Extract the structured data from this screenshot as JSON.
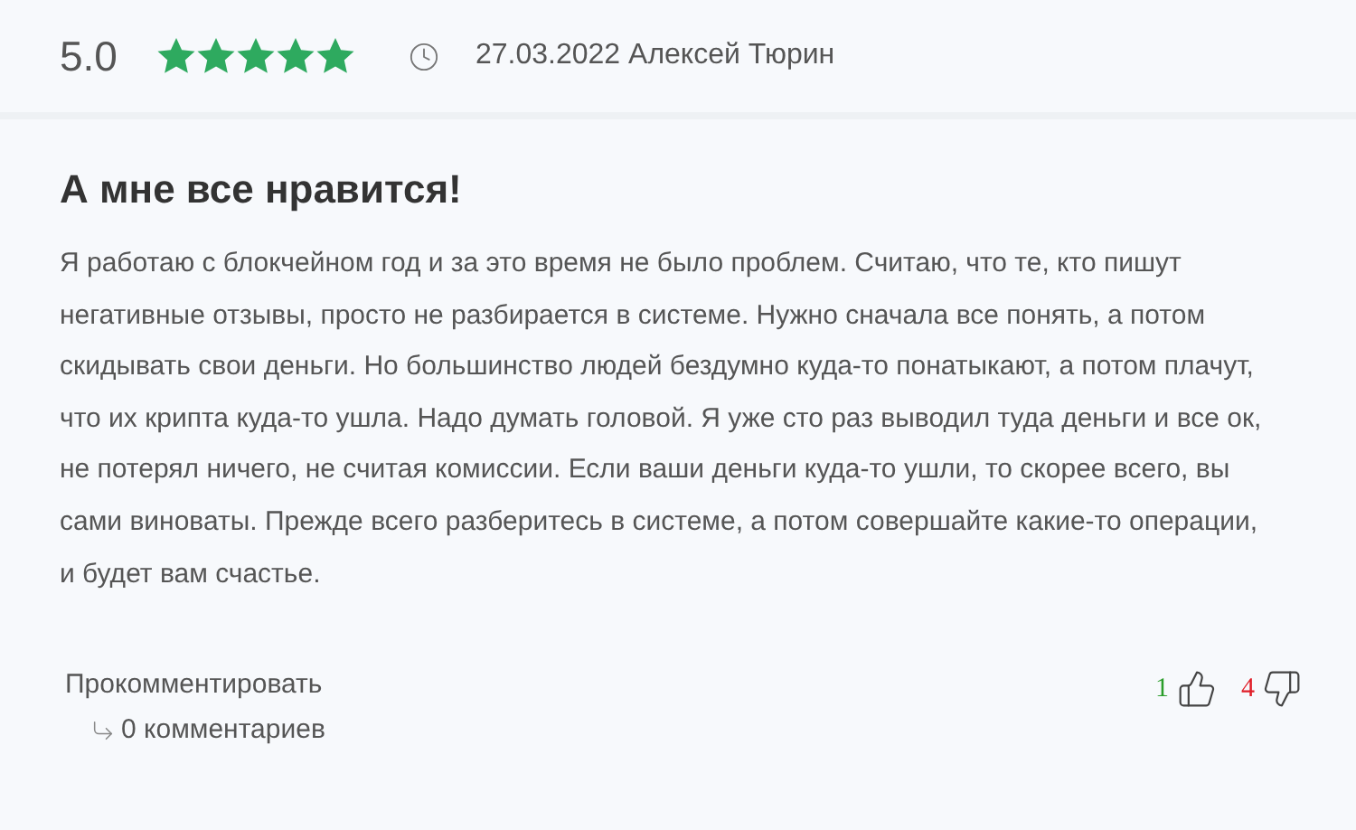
{
  "review": {
    "rating": "5.0",
    "stars": 5,
    "date": "27.03.2022",
    "author": "Алексей Тюрин",
    "title": "А мне все нравится!",
    "text": "Я работаю с блокчейном год и за это время не было проблем. Считаю, что те, кто пишут негативные отзывы, просто не разбирается в системе. Нужно сначала все понять, а потом скидывать свои деньги. Но большинство людей бездумно куда-то понатыкают, а потом плачут, что их крипта куда-то ушла. Надо думать головой. Я уже сто раз выводил туда деньги и все ок, не потерял ничего, не считая комиссии. Если ваши деньги куда-то ушли, то скорее всего, вы сами виноваты. Прежде всего разберитесь в системе, а потом совершайте какие-то операции, и будет вам счастье.",
    "comment_link": "Прокомментировать",
    "comments_count": "0 комментариев",
    "likes": "1",
    "dislikes": "4"
  }
}
